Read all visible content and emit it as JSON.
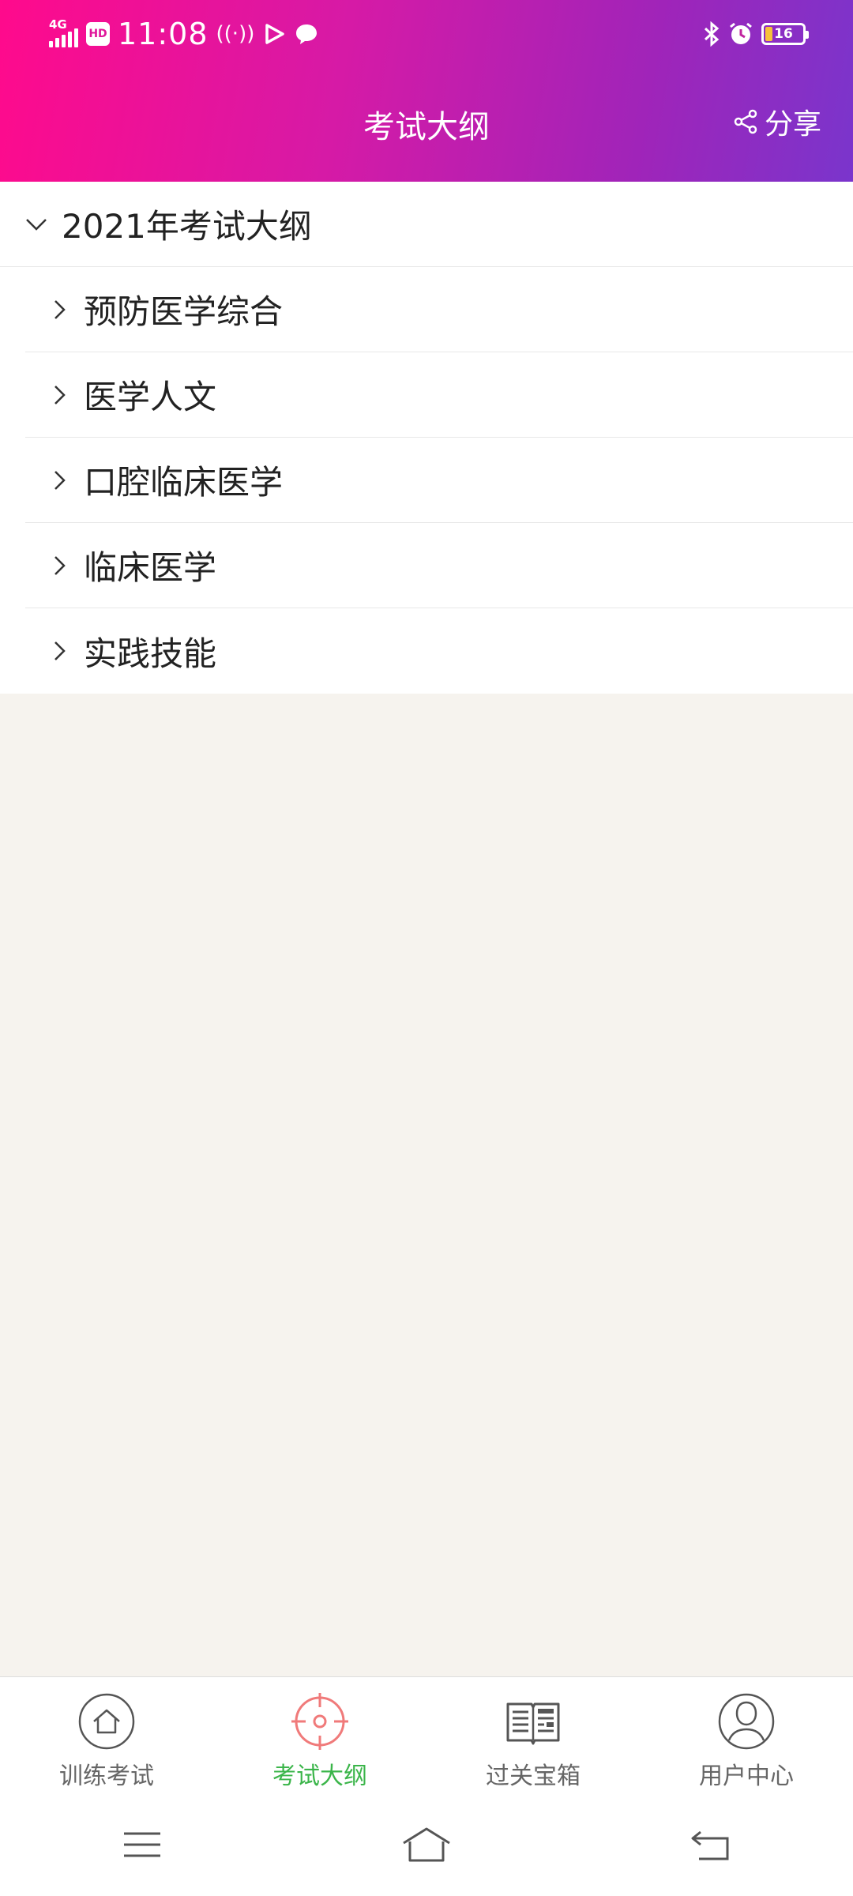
{
  "status_bar": {
    "network": "4G",
    "hd_label": "HD",
    "time": "11:08",
    "battery": "16"
  },
  "header": {
    "title": "考试大纲",
    "share_label": "分享"
  },
  "outline": {
    "group_title": "2021年考试大纲",
    "items": [
      {
        "label": "预防医学综合"
      },
      {
        "label": "医学人文"
      },
      {
        "label": "口腔临床医学"
      },
      {
        "label": "临床医学"
      },
      {
        "label": "实践技能"
      }
    ]
  },
  "tabbar": {
    "tabs": [
      {
        "label": "训练考试",
        "icon": "home-icon"
      },
      {
        "label": "考试大纲",
        "icon": "target-icon"
      },
      {
        "label": "过关宝箱",
        "icon": "book-icon"
      },
      {
        "label": "用户中心",
        "icon": "user-icon"
      }
    ],
    "active_color": "#3bb54a"
  },
  "colors": {
    "header_gradient_start": "#ff0a8c",
    "header_gradient_end": "#7a35cc",
    "page_background": "#f6f3ee"
  }
}
